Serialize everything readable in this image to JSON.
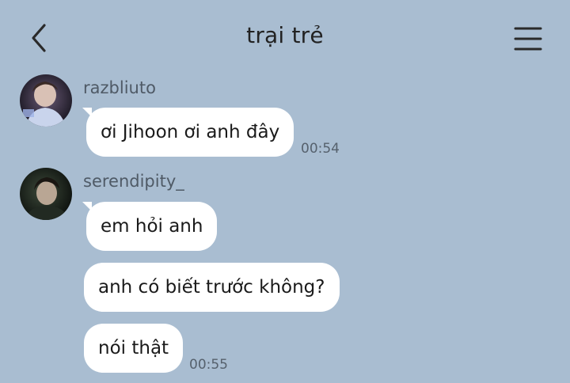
{
  "header": {
    "title": "trại trẻ",
    "back_icon": "chevron-left-icon",
    "menu_icon": "hamburger-menu-icon"
  },
  "colors": {
    "background": "#a9bdd1",
    "bubble": "#ffffff"
  },
  "messages": [
    {
      "sender": "razbliuto",
      "bubbles": [
        "ơi Jihoon ơi anh đây"
      ],
      "time": "00:54"
    },
    {
      "sender": "serendipity_",
      "bubbles": [
        "em hỏi anh",
        "anh có biết trước không?",
        "nói thật"
      ],
      "time": "00:55"
    }
  ]
}
